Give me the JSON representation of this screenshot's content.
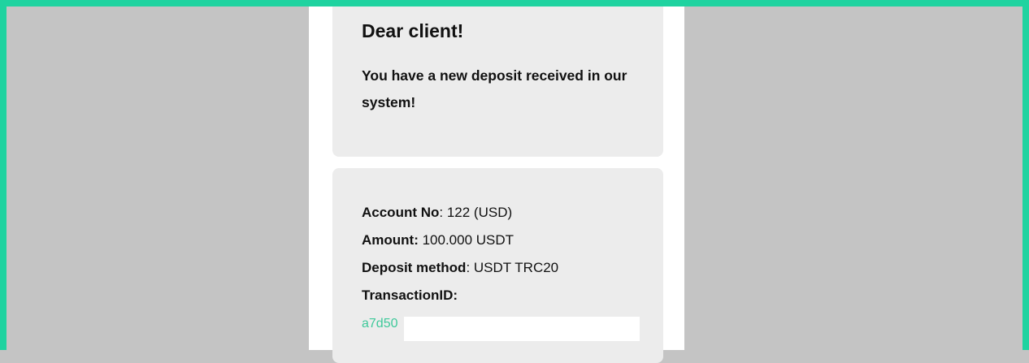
{
  "greeting": {
    "title": "Dear client!",
    "message": "You have a new deposit received in our system!"
  },
  "deposit_details": {
    "account_no_label": "Account No",
    "account_no_value": ": 122 (USD)",
    "amount_label": "Amount:",
    "amount_value": " 100.000 USDT",
    "method_label": "Deposit method",
    "method_value": ": USDT TRC20",
    "transaction_id_label": "TransactionID:",
    "transaction_id_visible": "a7d50"
  },
  "colors": {
    "frame": "#1fd3a0",
    "transaction_link": "#3ec99a",
    "card_background": "#ececec"
  }
}
